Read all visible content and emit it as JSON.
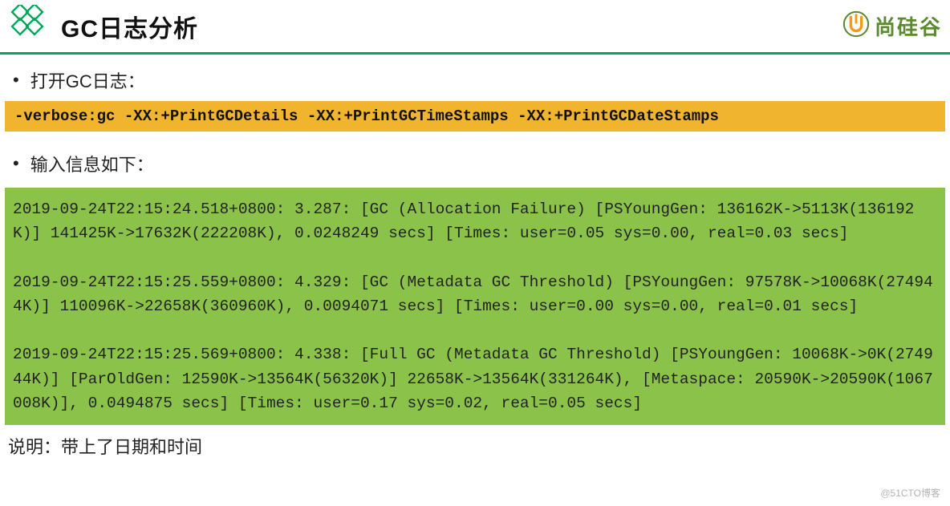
{
  "header": {
    "title": "GC日志分析",
    "brand_text": "尚硅谷"
  },
  "bullets": {
    "open_log": "打开GC日志：",
    "input_info": "输入信息如下："
  },
  "code": {
    "command": "-verbose:gc -XX:+PrintGCDetails -XX:+PrintGCTimeStamps -XX:+PrintGCDateStamps",
    "log_output": "2019-09-24T22:15:24.518+0800: 3.287: [GC (Allocation Failure) [PSYoungGen: 136162K->5113K(136192K)] 141425K->17632K(222208K), 0.0248249 secs] [Times: user=0.05 sys=0.00, real=0.03 secs]\n\n2019-09-24T22:15:25.559+0800: 4.329: [GC (Metadata GC Threshold) [PSYoungGen: 97578K->10068K(274944K)] 110096K->22658K(360960K), 0.0094071 secs] [Times: user=0.00 sys=0.00, real=0.01 secs]\n\n2019-09-24T22:15:25.569+0800: 4.338: [Full GC (Metadata GC Threshold) [PSYoungGen: 10068K->0K(274944K)] [ParOldGen: 12590K->13564K(56320K)] 22658K->13564K(331264K), [Metaspace: 20590K->20590K(1067008K)], 0.0494875 secs] [Times: user=0.17 sys=0.02, real=0.05 secs]"
  },
  "note": "说明：带上了日期和时间",
  "watermark": "@51CTO博客"
}
